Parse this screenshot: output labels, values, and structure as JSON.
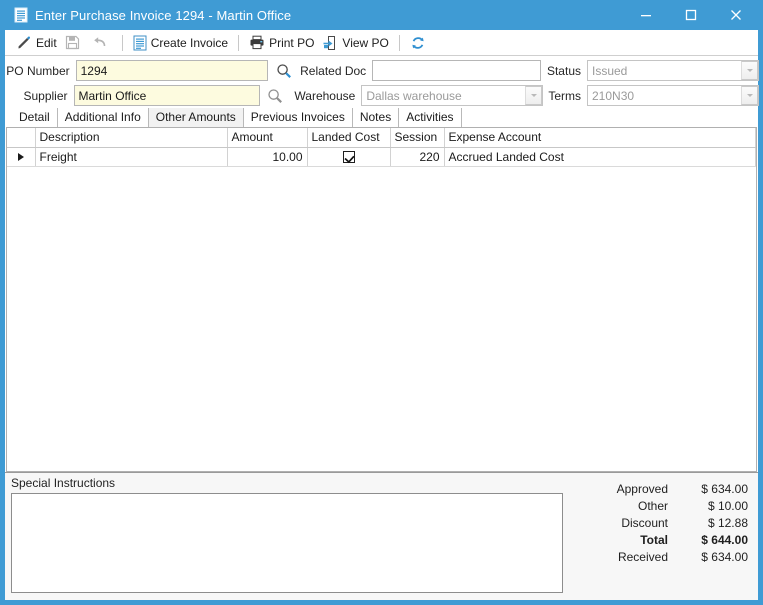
{
  "window": {
    "title": "Enter Purchase Invoice 1294 - Martin Office",
    "app_icon": "document-icon",
    "minimize_label": "Minimize",
    "maximize_label": "Maximize",
    "close_label": "Close",
    "accent_color": "#3f9bd4"
  },
  "toolbar": {
    "items": [
      {
        "label": "Edit",
        "icon": "pencil-icon",
        "enabled": true
      },
      {
        "label": "",
        "icon": "save-icon",
        "enabled": false
      },
      {
        "label": "",
        "icon": "undo-icon",
        "enabled": false
      },
      {
        "label": "Create Invoice",
        "icon": "document-icon",
        "enabled": true
      },
      {
        "label": "Print PO",
        "icon": "printer-icon",
        "enabled": true
      },
      {
        "label": "View PO",
        "icon": "view-document-icon",
        "enabled": true
      },
      {
        "label": "",
        "icon": "refresh-icon",
        "enabled": true
      }
    ]
  },
  "header": {
    "po_number": {
      "label": "PO Number",
      "value": "1294",
      "lookup_icon": "search-icon"
    },
    "supplier": {
      "label": "Supplier",
      "value": "Martin Office",
      "lookup_icon": "search-icon"
    },
    "related_doc": {
      "label": "Related Doc",
      "value": "",
      "placeholder": ""
    },
    "warehouse": {
      "label": "Warehouse",
      "value": "Dallas warehouse"
    },
    "status": {
      "label": "Status",
      "value": "Issued"
    },
    "terms": {
      "label": "Terms",
      "value": "210N30"
    }
  },
  "tabs": {
    "items": [
      {
        "label": "Detail",
        "active": false
      },
      {
        "label": "Additional Info",
        "active": false
      },
      {
        "label": "Other Amounts",
        "active": true
      },
      {
        "label": "Previous Invoices",
        "active": false
      },
      {
        "label": "Notes",
        "active": false
      },
      {
        "label": "Activities",
        "active": false
      }
    ]
  },
  "grid": {
    "columns": [
      "Description",
      "Amount",
      "Landed Cost",
      "Session",
      "Expense Account"
    ],
    "rows": [
      {
        "selected": true,
        "description": "Freight",
        "amount": "10.00",
        "landed_cost": true,
        "session": "220",
        "expense_account": "Accrued Landed Cost"
      }
    ]
  },
  "special_instructions": {
    "label": "Special Instructions",
    "value": "",
    "placeholder": ""
  },
  "totals": {
    "rows": [
      {
        "label": "Approved",
        "value": "$ 634.00",
        "bold": false
      },
      {
        "label": "Other",
        "value": "$ 10.00",
        "bold": false
      },
      {
        "label": "Discount",
        "value": "$ 12.88",
        "bold": false
      },
      {
        "label": "Total",
        "value": "$ 644.00",
        "bold": true
      },
      {
        "label": "Received",
        "value": "$ 634.00",
        "bold": false
      }
    ]
  }
}
